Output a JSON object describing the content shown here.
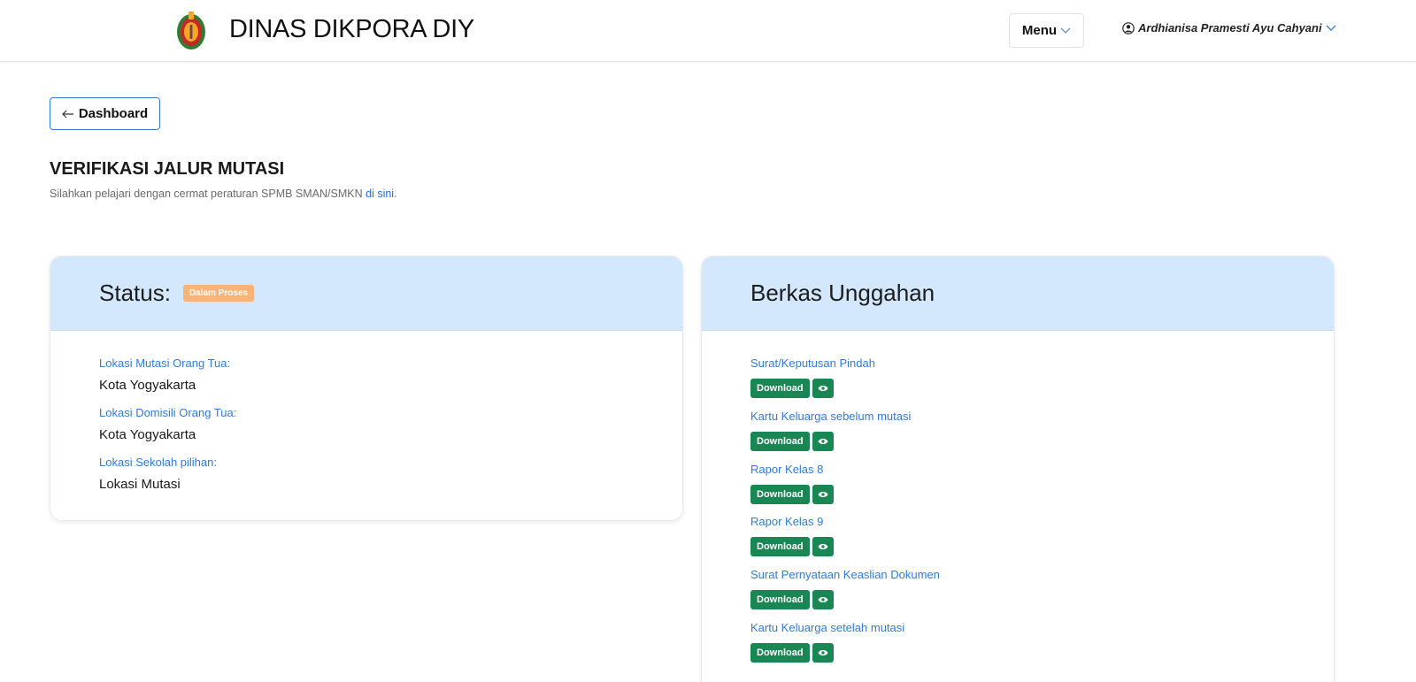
{
  "header": {
    "brand": "DINAS DIKPORA DIY",
    "menu_label": "Menu",
    "user_name": "Ardhianisa Pramesti Ayu Cahyani"
  },
  "nav": {
    "dashboard_label": "Dashboard"
  },
  "page": {
    "title": "VERIFIKASI JALUR MUTASI",
    "subtitle": "Silahkan pelajari dengan cermat peraturan SPMB SMAN/SMKN ",
    "subtitle_link": "di sini",
    "subtitle_end": "."
  },
  "status_card": {
    "title": "Status:",
    "badge": "Dalam Proses",
    "fields": [
      {
        "label": "Lokasi Mutasi Orang Tua:",
        "value": "Kota Yogyakarta"
      },
      {
        "label": "Lokasi Domisili Orang Tua:",
        "value": "Kota Yogyakarta"
      },
      {
        "label": "Lokasi Sekolah pilihan:",
        "value": "Lokasi Mutasi"
      }
    ]
  },
  "files_card": {
    "title": "Berkas Unggahan",
    "download_label": "Download",
    "files": [
      {
        "label": "Surat/Keputusan Pindah"
      },
      {
        "label": "Kartu Keluarga sebelum mutasi"
      },
      {
        "label": "Rapor Kelas 8"
      },
      {
        "label": "Rapor Kelas 9"
      },
      {
        "label": "Surat Pernyataan Keaslian Dokumen"
      },
      {
        "label": "Kartu Keluarga setelah mutasi"
      }
    ]
  },
  "colors": {
    "accent": "#2f7bd9",
    "card_header": "#d4e8fd",
    "badge": "#f8b478",
    "download": "#198754"
  }
}
